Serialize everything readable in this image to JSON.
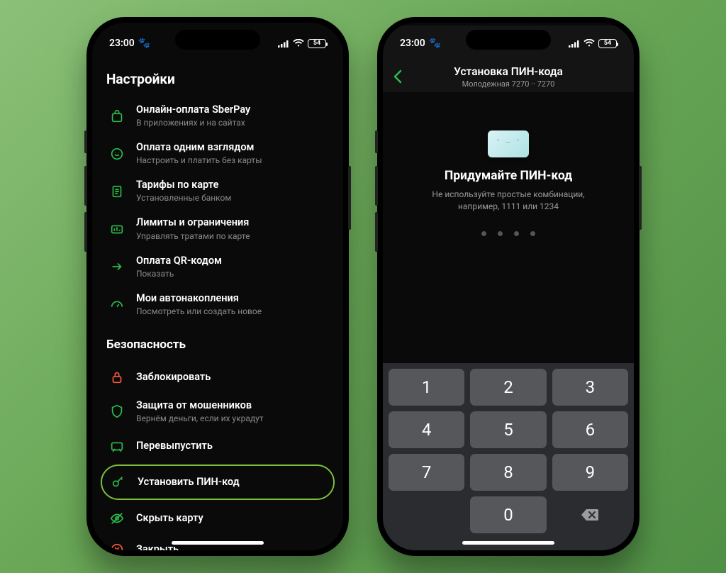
{
  "status": {
    "time": "23:00",
    "battery": "54"
  },
  "phone1": {
    "section_settings": "Настройки",
    "section_security": "Безопасность",
    "rows": [
      {
        "title": "Онлайн-оплата SberPay",
        "sub": "В приложениях и на сайтах",
        "icon": "shopping-bag-icon"
      },
      {
        "title": "Оплата одним взглядом",
        "sub": "Настроить и платить без карты",
        "icon": "face-pay-icon"
      },
      {
        "title": "Тарифы по карте",
        "sub": "Установленные банком",
        "icon": "document-icon"
      },
      {
        "title": "Лимиты и ограничения",
        "sub": "Управлять тратами по карте",
        "icon": "limits-icon"
      },
      {
        "title": "Оплата QR-кодом",
        "sub": "Показать",
        "icon": "arrow-right-icon"
      },
      {
        "title": "Мои автонакопления",
        "sub": "Посмотреть или создать новое",
        "icon": "gauge-icon"
      }
    ],
    "security": [
      {
        "title": "Заблокировать",
        "icon": "lock-icon",
        "red": true
      },
      {
        "title": "Защита от мошенников",
        "sub": "Вернём деньги, если их украдут",
        "icon": "shield-icon"
      },
      {
        "title": "Перевыпустить",
        "icon": "card-reissue-icon"
      },
      {
        "title": "Установить ПИН-код",
        "icon": "key-icon",
        "highlight": true
      },
      {
        "title": "Скрыть карту",
        "icon": "eye-off-icon"
      },
      {
        "title": "Закрыть",
        "icon": "close-circle-icon",
        "red": true
      }
    ]
  },
  "phone2": {
    "nav_title": "Установка ПИН-кода",
    "nav_sub": "Молодежная 7270 ·· 7270",
    "heading": "Придумайте ПИН-код",
    "desc1": "Не используйте простые комбинации,",
    "desc2": "например, 1111 или 1234",
    "keys": [
      "1",
      "2",
      "3",
      "4",
      "5",
      "6",
      "7",
      "8",
      "9",
      "",
      "0",
      "⌫"
    ]
  }
}
